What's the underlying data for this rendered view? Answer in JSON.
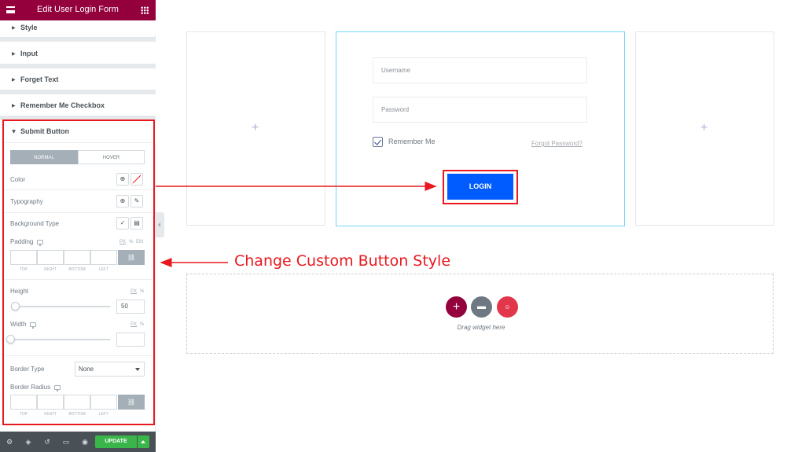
{
  "sidebar": {
    "title": "Edit User Login Form",
    "sections": [
      "Style",
      "Input",
      "Forget Text",
      "Remember Me Checkbox"
    ],
    "submit": {
      "title": "Submit Button",
      "tabs": [
        "NORMAL",
        "HOVER"
      ],
      "color_label": "Color",
      "typography_label": "Typography",
      "background_type_label": "Background Type",
      "padding_label": "Padding",
      "units_px_pct_em": [
        "PX",
        "%",
        "EM"
      ],
      "dims": [
        "TOP",
        "RIGHT",
        "BOTTOM",
        "LEFT"
      ],
      "height_label": "Height",
      "height_units": [
        "PX",
        "%"
      ],
      "height_value": "50",
      "width_label": "Width",
      "width_units": [
        "PX",
        "%"
      ],
      "border_type_label": "Border Type",
      "border_type_value": "None",
      "border_radius_label": "Border Radius"
    },
    "update_label": "UPDATE"
  },
  "canvas": {
    "username_placeholder": "Username",
    "password_placeholder": "Password",
    "remember_label": "Remember Me",
    "remember_checked": true,
    "forgot_label": "Forgot Password?",
    "login_label": "LOGIN",
    "dropzone_text": "Drag widget here",
    "plus": "+"
  },
  "annotation": "Change Custom Button Style",
  "colors": {
    "header": "#93003c",
    "accent": "#005cff",
    "highlight": "#e8181e",
    "update": "#39b54a"
  }
}
